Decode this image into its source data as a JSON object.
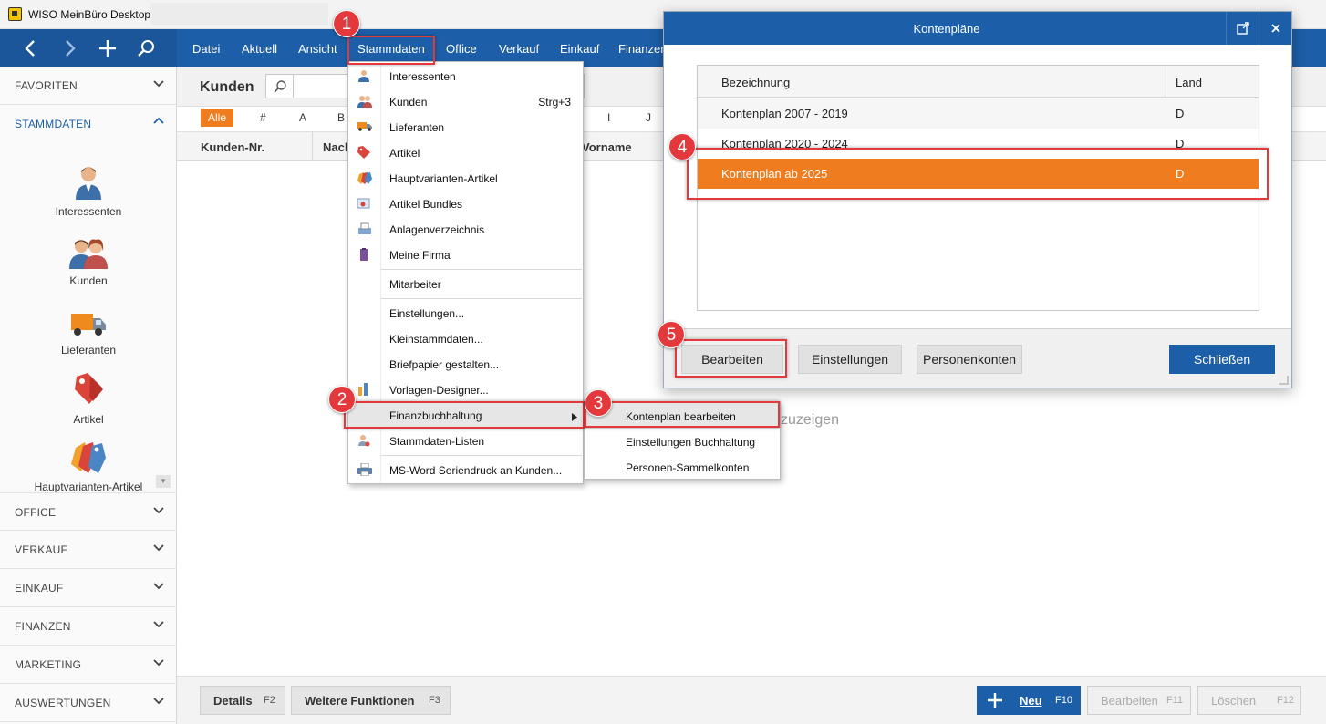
{
  "window": {
    "title": "WISO MeinBüro Desktop",
    "brand_color": "#1c5fa8",
    "accent_color": "#ef7d1f",
    "callout_color": "#e3393c"
  },
  "nav": {
    "tool_icons": [
      "back-arrow-icon",
      "forward-arrow-icon",
      "plus-icon",
      "search-icon"
    ],
    "menu": [
      "Datei",
      "Aktuell",
      "Ansicht",
      "Stammdaten",
      "Office",
      "Verkauf",
      "Einkauf",
      "Finanzen"
    ]
  },
  "sidebar": {
    "favoriten": "FAVORITEN",
    "stammdaten": "STAMMDATEN",
    "entries": [
      "Interessenten",
      "Kunden",
      "Lieferanten",
      "Artikel",
      "Hauptvarianten-Artikel"
    ],
    "sections": [
      "OFFICE",
      "VERKAUF",
      "EINKAUF",
      "FINANZEN",
      "MARKETING",
      "AUSWERTUNGEN"
    ]
  },
  "main": {
    "title": "Kunden",
    "search_value": "",
    "alpha": [
      "Alle",
      "#",
      "A",
      "B",
      "I",
      "J"
    ],
    "columns": [
      "Kunden-Nr.",
      "Nach",
      "Vorname"
    ],
    "empty_hint": "zuzeigen"
  },
  "bottom": {
    "details": "Details",
    "details_key": "F2",
    "more": "Weitere Funktionen",
    "more_key": "F3",
    "new": "Neu",
    "new_key": "F10",
    "edit": "Bearbeiten",
    "edit_key": "F11",
    "delete": "Löschen",
    "delete_key": "F12"
  },
  "dropdown": {
    "items": [
      {
        "label": "Interessenten",
        "shortcut": "",
        "icon": "person-icon"
      },
      {
        "label": "Kunden",
        "shortcut": "Strg+3",
        "icon": "customers-icon"
      },
      {
        "label": "Lieferanten",
        "shortcut": "",
        "icon": "truck-icon"
      },
      {
        "label": "Artikel",
        "shortcut": "",
        "icon": "tag-icon"
      },
      {
        "label": "Hauptvarianten-Artikel",
        "shortcut": "",
        "icon": "tags-icon"
      },
      {
        "label": "Artikel Bundles",
        "shortcut": "",
        "icon": "bundle-icon"
      },
      {
        "label": "Anlagenverzeichnis",
        "shortcut": "",
        "icon": "asset-icon"
      },
      {
        "label": "Meine Firma",
        "shortcut": "",
        "icon": "company-icon"
      },
      {
        "label": "Mitarbeiter",
        "shortcut": "",
        "icon": ""
      },
      {
        "label": "Einstellungen...",
        "shortcut": "",
        "icon": ""
      },
      {
        "label": "Kleinstammdaten...",
        "shortcut": "",
        "icon": ""
      },
      {
        "label": "Briefpapier gestalten...",
        "shortcut": "",
        "icon": ""
      },
      {
        "label": "Vorlagen-Designer...",
        "shortcut": "",
        "icon": "designer-icon"
      },
      {
        "label": "Finanzbuchhaltung",
        "shortcut": "",
        "icon": ""
      },
      {
        "label": "Stammdaten-Listen",
        "shortcut": "",
        "icon": "list-icon"
      },
      {
        "label": "MS-Word Seriendruck an Kunden...",
        "shortcut": "",
        "icon": "printer-icon"
      }
    ],
    "submenu": [
      "Kontenplan bearbeiten",
      "Einstellungen Buchhaltung",
      "Personen-Sammelkonten"
    ]
  },
  "dialog": {
    "title": "Kontenpläne",
    "col_name": "Bezeichnung",
    "col_country": "Land",
    "rows": [
      {
        "name": "Kontenplan 2007 - 2019",
        "country": "D"
      },
      {
        "name": "Kontenplan 2020 - 2024",
        "country": "D"
      },
      {
        "name": "Kontenplan ab 2025",
        "country": "D"
      }
    ],
    "btn_edit": "Bearbeiten",
    "btn_settings": "Einstellungen",
    "btn_accounts": "Personenkonten",
    "btn_close": "Schließen"
  },
  "callouts": [
    "1",
    "2",
    "3",
    "4",
    "5"
  ]
}
